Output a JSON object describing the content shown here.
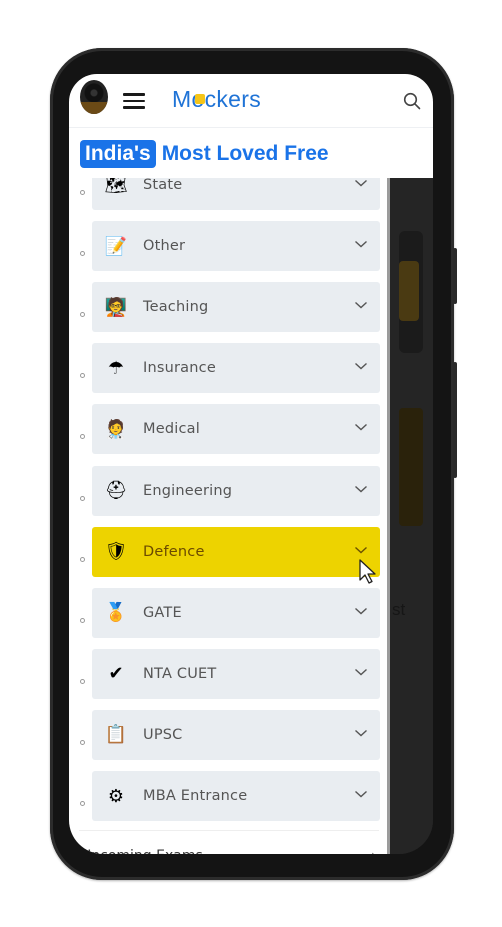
{
  "header": {
    "logo_text_before": "M",
    "logo_text_after": "ckers",
    "menu_icon": "hamburger-icon",
    "search_icon": "search-icon"
  },
  "banner": {
    "highlight": "India's",
    "text": "Most Loved Free"
  },
  "drawer": {
    "items": [
      {
        "label": "State",
        "icon": "india-map-icon",
        "glyph": "🗺"
      },
      {
        "label": "Other",
        "icon": "notepad-icon",
        "glyph": "📝"
      },
      {
        "label": "Teaching",
        "icon": "teacher-icon",
        "glyph": "🧑‍🏫"
      },
      {
        "label": "Insurance",
        "icon": "umbrella-icon",
        "glyph": "☂"
      },
      {
        "label": "Medical",
        "icon": "doctor-icon",
        "glyph": "🧑‍⚕️"
      },
      {
        "label": "Engineering",
        "icon": "hardhat-gear-icon",
        "glyph": "⛑"
      },
      {
        "label": "Defence",
        "icon": "badge-shield-icon",
        "glyph": "🛡",
        "active": true
      },
      {
        "label": "GATE",
        "icon": "gate-medal-icon",
        "glyph": "🏅"
      },
      {
        "label": "NTA CUET",
        "icon": "check-circle-icon",
        "glyph": "✔"
      },
      {
        "label": "UPSC",
        "icon": "clipboard-icon",
        "glyph": "📋"
      },
      {
        "label": "MBA Entrance",
        "icon": "gear-hand-icon",
        "glyph": "⚙"
      }
    ],
    "footer_item": "Upcoming Exams",
    "active_color": "#edd300"
  },
  "background_text": "st",
  "colors": {
    "brand": "#1a73e8",
    "item_bg": "#e9edf1",
    "active": "#edd300"
  }
}
